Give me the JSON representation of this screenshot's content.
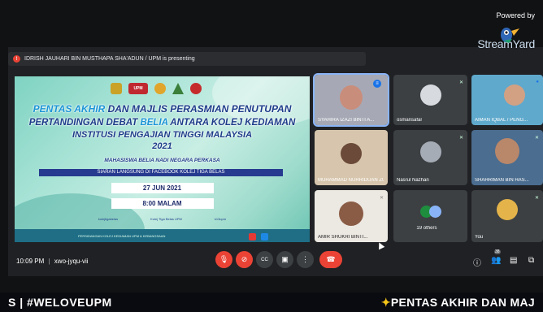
{
  "banner": {
    "text": "IDRISH JAUHARI BIN MUSTHAPA SHA'ADUN / UPM is presenting",
    "icon": "present-icon"
  },
  "branding": {
    "powered_by": "Powered by",
    "logo": "StreamYard"
  },
  "slide": {
    "logos": [
      "crest",
      "upm",
      "leaf",
      "triangle",
      "red-emblem"
    ],
    "upm": "UPM",
    "line1_a": "PENTAS AKHIR",
    "line1_b": " DAN MAJLIS PERASMIAN PENUTUPAN",
    "line2_a": "PERTANDINGAN DEBAT ",
    "line2_b": "BELIA",
    "line2_c": " ANTARA KOLEJ KEDIAMAN",
    "line3": "INSTITUSI PENGAJIAN TINGGI MALAYSIA",
    "year": "2021",
    "tagline": "MAHASISWA BELIA NADI NEGARA PERKASA",
    "live": "SIARAN LANGSUNG DI FACEBOOK KOLEJ TIGA BELAS",
    "date": "27 JUN 2021",
    "time": "8:00 MALAM",
    "footer_items": [
      "kolejtigabelas",
      "Kolej Tiga Belas UPM",
      "k13upm"
    ],
    "footer_strip": "PERSIDANGAN KOLEJ KEDIAMAN UPM & KEBANGSAAN"
  },
  "tiles": [
    {
      "name": "SYAHIRA IZAZI BINTI A...",
      "pinned": false,
      "selected": true
    },
    {
      "name": "osmansafar",
      "pinned": true,
      "selected": false
    },
    {
      "name": "AIMAN IQBAL / PENG...",
      "pinned": false,
      "selected": false
    },
    {
      "name": "MUHAMMAD NURRIDUAN ZUL...",
      "pinned": false,
      "selected": false
    },
    {
      "name": "Nasrul Nazhan",
      "pinned": true,
      "selected": false
    },
    {
      "name": "SHAHRIMAN BIN HAS...",
      "pinned": true,
      "selected": false
    },
    {
      "name": "AMIR SHUKRI BINTI...",
      "pinned": false,
      "selected": false
    },
    {
      "name": "19 others",
      "pinned": false,
      "selected": false
    },
    {
      "name": "You",
      "pinned": true,
      "selected": false
    }
  ],
  "bottom": {
    "time": "10:09 PM",
    "sep": "|",
    "code": "xwo-jyqu-vii",
    "participants": "38"
  },
  "ticker": {
    "left": "S | #WELOVEUPM",
    "right": "PENTAS AKHIR DAN MAJ"
  }
}
